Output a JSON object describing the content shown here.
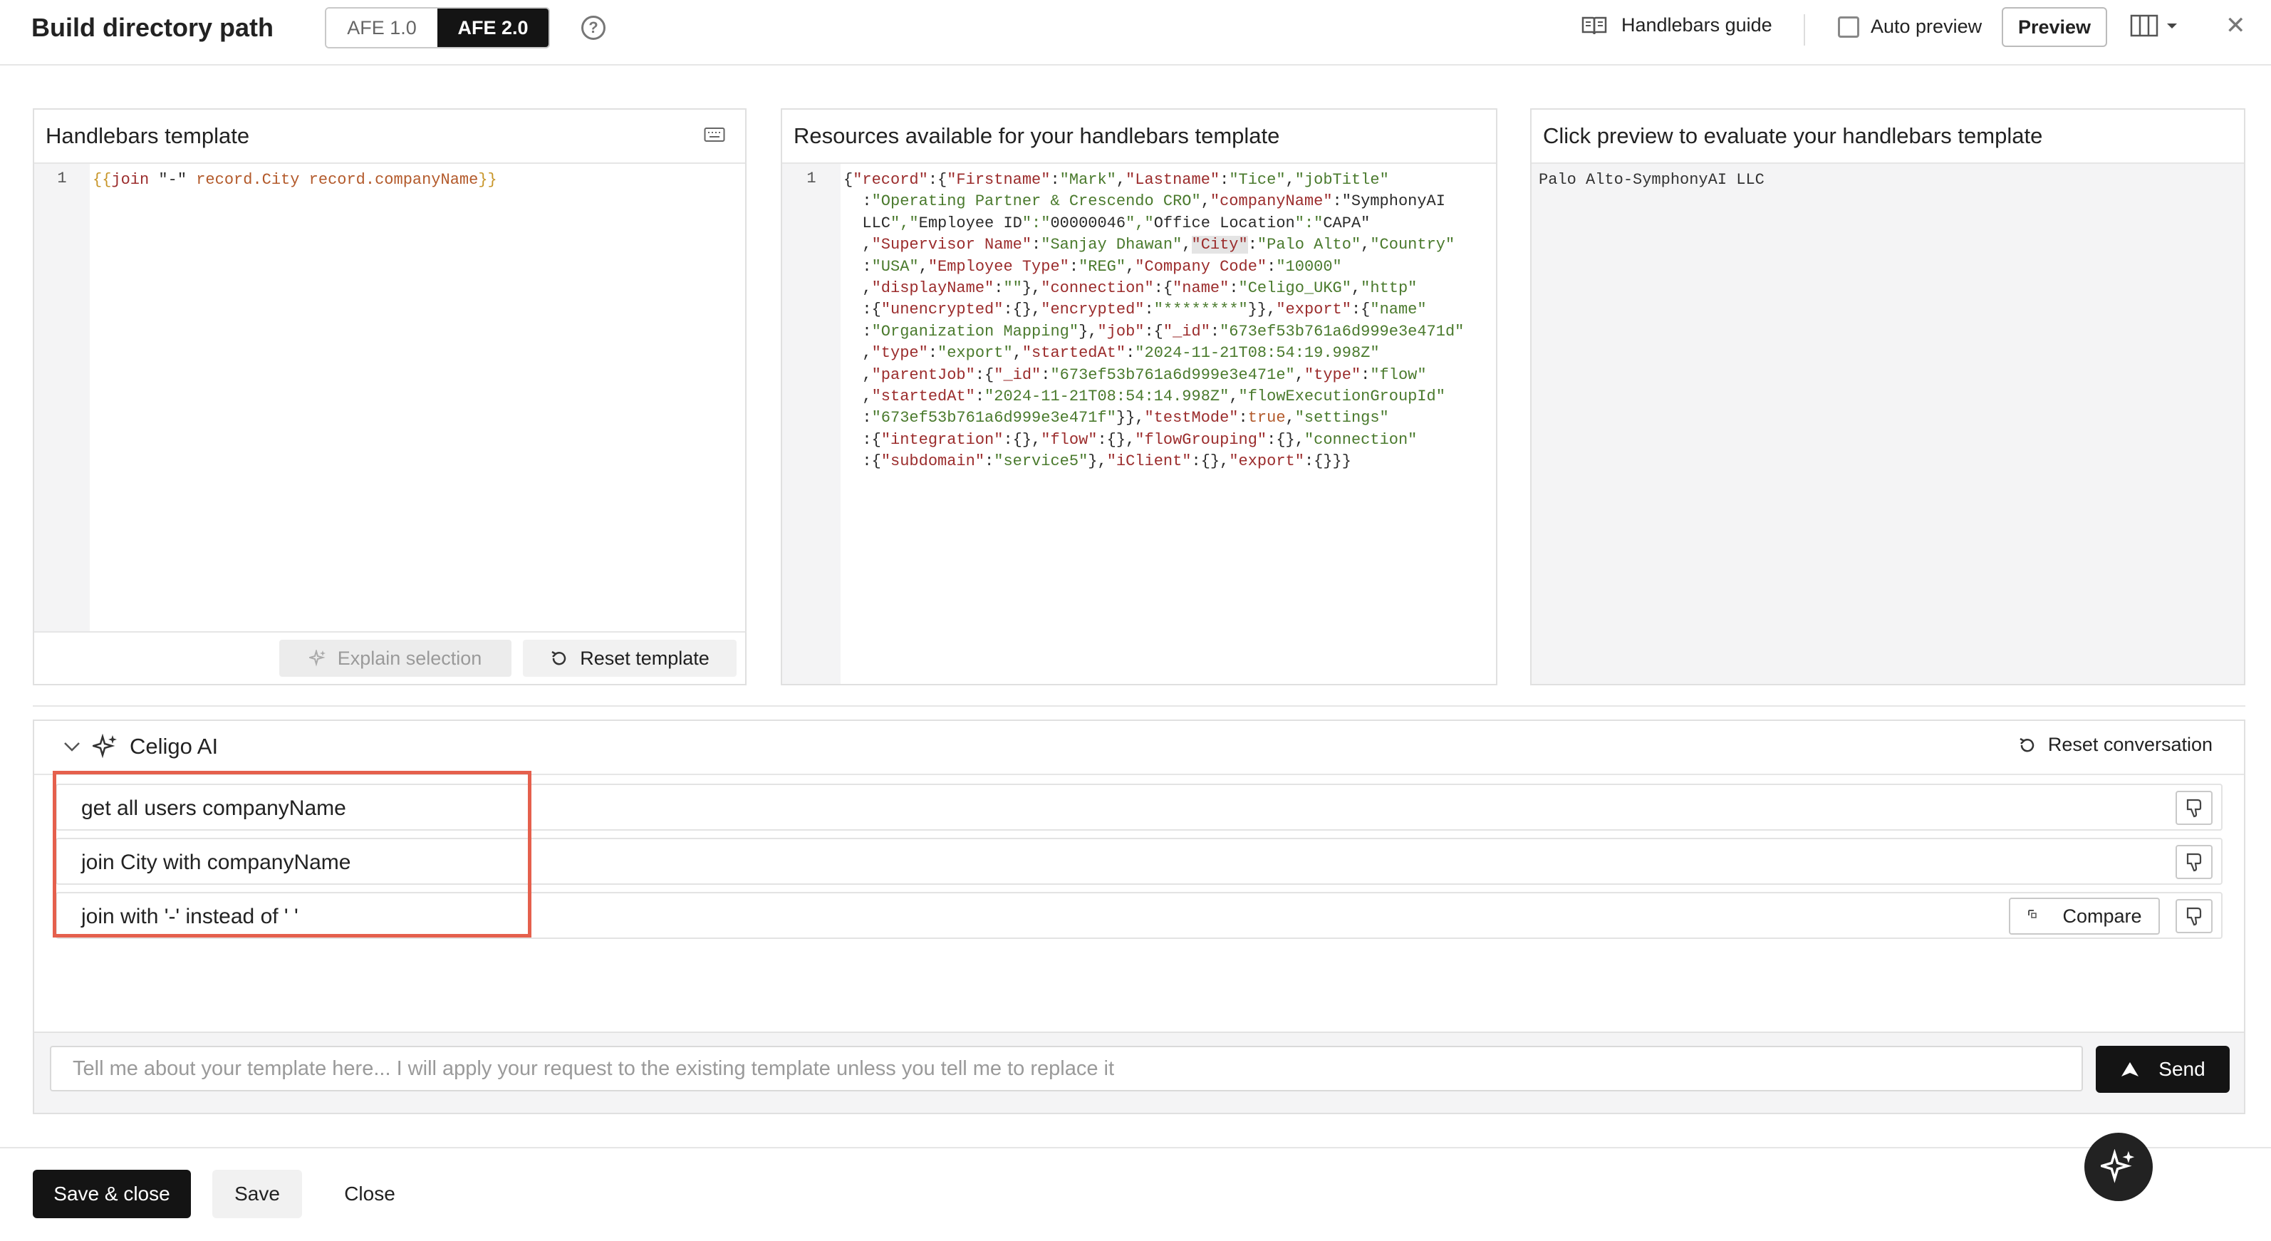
{
  "header": {
    "title": "Build directory path",
    "afe_versions": [
      "AFE 1.0",
      "AFE 2.0"
    ],
    "selected_afe": "AFE 2.0",
    "help_icon": "question-circle-icon",
    "guide_label": "Handlebars guide",
    "auto_preview_label": "Auto preview",
    "auto_preview_checked": false,
    "preview_label": "Preview",
    "close_icon": "close-icon"
  },
  "template_panel": {
    "title": "Handlebars template",
    "line_number": "1",
    "code_tokens": [
      "{{",
      "join",
      " \"-\" ",
      "record",
      ".City ",
      "record",
      ".companyName",
      "}}"
    ],
    "explain_label": "Explain selection",
    "reset_label": "Reset template"
  },
  "resources_panel": {
    "title": "Resources available for your handlebars template",
    "line_number": "1",
    "code_lines": [
      "{\"record\":{\"Firstname\":\"Mark\",\"Lastname\":\"Tice\",\"jobTitle\"",
      "  :\"Operating Partner & Crescendo CRO\",\"companyName\":\"SymphonyAI",
      "  LLC\",\"Employee ID\":\"00000046\",\"Office Location\":\"CAPA\"",
      "  ,\"Supervisor Name\":\"Sanjay Dhawan\",\"City\":\"Palo Alto\",\"Country\"",
      "  :\"USA\",\"Employee Type\":\"REG\",\"Company Code\":\"10000\"",
      "  ,\"displayName\":\"\"},\"connection\":{\"name\":\"Celigo_UKG\",\"http\"",
      "  :{\"unencrypted\":{},\"encrypted\":\"********\"}},\"export\":{\"name\"",
      "  :\"Organization Mapping\"},\"job\":{\"_id\":\"673ef53b761a6d999e3e471d\"",
      "  ,\"type\":\"export\",\"startedAt\":\"2024-11-21T08:54:19.998Z\"",
      "  ,\"parentJob\":{\"_id\":\"673ef53b761a6d999e3e471e\",\"type\":\"flow\"",
      "  ,\"startedAt\":\"2024-11-21T08:54:14.998Z\",\"flowExecutionGroupId\"",
      "  :\"673ef53b761a6d999e3e471f\"}},\"testMode\":true,\"settings\"",
      "  :{\"integration\":{},\"flow\":{},\"flowGrouping\":{},\"connection\"",
      "  :{\"subdomain\":\"service5\"},\"iClient\":{},\"export\":{}}}"
    ]
  },
  "preview_panel": {
    "title": "Click preview to evaluate your handlebars template",
    "result": "Palo Alto-SymphonyAI LLC"
  },
  "ai_panel": {
    "title": "Celigo AI",
    "reset_label": "Reset conversation",
    "messages": [
      {
        "text": "get all users companyName"
      },
      {
        "text": "join City with companyName"
      },
      {
        "text": "join with '-' instead of ' '"
      }
    ],
    "compare_label": "Compare",
    "input_placeholder": "Tell me about your template here... I will apply your request to the existing template unless you tell me to replace it",
    "send_label": "Send"
  },
  "footer": {
    "save_close_label": "Save & close",
    "save_label": "Save",
    "close_label": "Close"
  },
  "colors": {
    "primary": "#141414",
    "highlight_border": "#e5604d",
    "code_key": "#9b2c2c",
    "code_string": "#4a7a2d"
  }
}
